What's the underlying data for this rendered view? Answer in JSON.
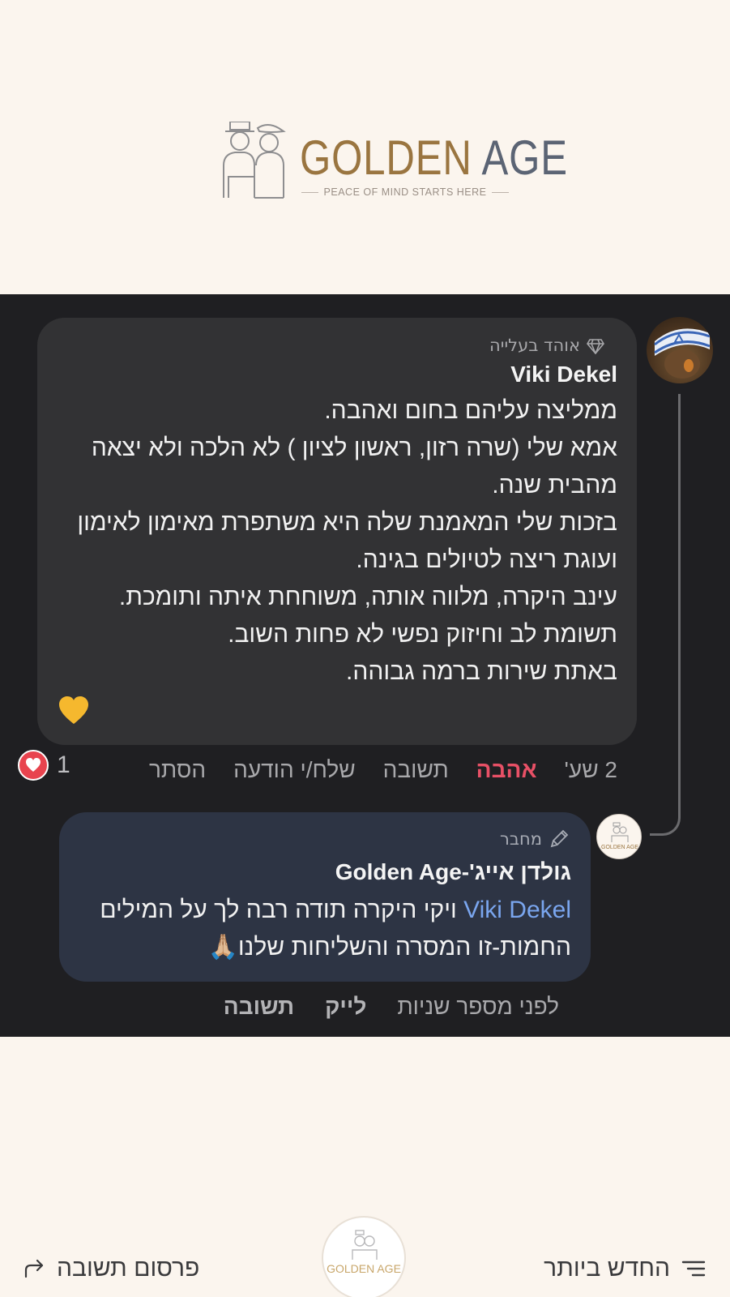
{
  "header": {
    "logo_word1": "GOLDEN",
    "logo_word2": "AGE",
    "tagline": "PEACE OF MIND STARTS HERE"
  },
  "comment": {
    "badge": "אוהד בעלייה",
    "author": "Viki Dekel",
    "lines": [
      "ממליצה עליהם בחום ואהבה.",
      "אמא שלי (שרה רזון, ראשון לציון ) לא הלכה ולא יצאה מהבית שנה.",
      "בזכות שלי המאמנת שלה היא משתפרת מאימון לאימון ועוגת ריצה לטיולים בגינה.",
      "עינב היקרה, מלווה אותה, משוחחת איתה ותומכת.",
      "תשומת לב וחיזוק נפשי לא פחות השוב.",
      "באתת שירות ברמה גבוהה."
    ],
    "emoji": "💛",
    "actions": {
      "time": "2 שע'",
      "love": "אהבה",
      "reply": "תשובה",
      "message": "שלח/י הודעה",
      "hide": "הסתר"
    },
    "reaction_count": "1"
  },
  "reply": {
    "badge": "מחבר",
    "author": "גולדן אייג'-Golden Age",
    "mention": "Viki Dekel",
    "text": " ויקי היקרה תודה רבה לך על המילים החמות-זו המסרה והשליחות שלנו🙏🏼",
    "actions": {
      "time": "לפני מספר שניות",
      "like": "לייק",
      "reply": "תשובה"
    }
  },
  "bottom": {
    "newest": "החדש ביותר",
    "post_reply": "פרסום תשובה"
  },
  "colors": {
    "panel_bg": "#1f1f22",
    "bubble_bg": "#323234",
    "reply_bubble_bg": "#2d3444",
    "love_red": "#e85066",
    "mention_blue": "#7aa6ef",
    "page_bg": "#fbf5ee",
    "logo_gold": "#9a7540",
    "logo_slate": "#5b6474"
  },
  "icons": [
    "diamond-icon",
    "pencil-icon",
    "heart-icon",
    "sort-icon",
    "share-arrow-icon"
  ]
}
